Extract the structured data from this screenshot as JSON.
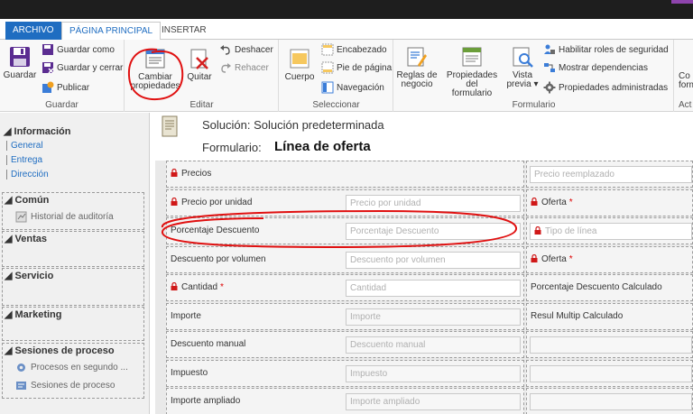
{
  "tabs": {
    "archivo": "ARCHIVO",
    "principal": "PÁGINA PRINCIPAL",
    "insertar": "INSERTAR"
  },
  "ribbon": {
    "guardar": {
      "save": "Guardar",
      "save_as": "Guardar como",
      "save_close": "Guardar y cerrar",
      "publish": "Publicar",
      "label": "Guardar"
    },
    "editar": {
      "change_props_1": "Cambiar",
      "change_props_2": "propiedades",
      "remove": "Quitar",
      "undo": "Deshacer",
      "redo": "Rehacer",
      "label": "Editar"
    },
    "seleccionar": {
      "body": "Cuerpo",
      "header": "Encabezado",
      "footer": "Pie de página",
      "navigation": "Navegación",
      "label": "Seleccionar"
    },
    "formulario": {
      "rules_1": "Reglas de",
      "rules_2": "negocio",
      "form_props_1": "Propiedades del",
      "form_props_2": "formulario",
      "preview_1": "Vista",
      "preview_2": "previa",
      "security_roles": "Habilitar roles de seguridad",
      "dependencies": "Mostrar dependencias",
      "managed_props": "Propiedades administradas",
      "label": "Formulario"
    },
    "cut_1": "Co",
    "cut_2": "form",
    "cut_label": "Act"
  },
  "leftnav": {
    "info_header": "Información",
    "info_items": [
      "General",
      "Entrega",
      "Dirección"
    ],
    "sections": [
      {
        "title": "Común",
        "items": [
          "Historial de auditoría"
        ]
      },
      {
        "title": "Ventas",
        "items": []
      },
      {
        "title": "Servicio",
        "items": []
      },
      {
        "title": "Marketing",
        "items": []
      },
      {
        "title": "Sesiones de proceso",
        "items": [
          "Procesos en segundo ...",
          "Sesiones de proceso"
        ]
      }
    ]
  },
  "header": {
    "solution": "Solución: Solución predeterminada",
    "form_label": "Formulario:",
    "form_name": "Línea de oferta"
  },
  "form": {
    "rows": [
      {
        "label": "Precios",
        "placeholder": "",
        "locked": true,
        "required": false,
        "right_label": "",
        "right_value": "Precio reemplazado",
        "right_locked": false
      },
      {
        "label": "Precio por unidad",
        "placeholder": "Precio por unidad",
        "locked": true,
        "required": false,
        "right_label": "Oferta",
        "right_value": "",
        "right_locked": true
      },
      {
        "label": "Porcentaje Descuento",
        "placeholder": "Porcentaje Descuento",
        "locked": false,
        "required": false,
        "right_label": "",
        "right_value": "Tipo de línea",
        "right_locked": true
      },
      {
        "label": "Descuento por volumen",
        "placeholder": "Descuento por volumen",
        "locked": false,
        "required": false,
        "right_label": "Oferta",
        "right_value": "",
        "right_locked": true
      },
      {
        "label": "Cantidad",
        "placeholder": "Cantidad",
        "locked": true,
        "required": true,
        "right_label": "Porcentaje Descuento Calculado",
        "right_value": "",
        "right_locked": false
      },
      {
        "label": "Importe",
        "placeholder": "Importe",
        "locked": false,
        "required": false,
        "right_label": "Resul Multip Calculado",
        "right_value": "",
        "right_locked": false
      },
      {
        "label": "Descuento manual",
        "placeholder": "Descuento manual",
        "locked": false,
        "required": false,
        "right_label": "",
        "right_value": "",
        "right_locked": false
      },
      {
        "label": "Impuesto",
        "placeholder": "Impuesto",
        "locked": false,
        "required": false,
        "right_label": "",
        "right_value": "",
        "right_locked": false
      },
      {
        "label": "Importe ampliado",
        "placeholder": "Importe ampliado",
        "locked": false,
        "required": false,
        "right_label": "",
        "right_value": "",
        "right_locked": false
      }
    ]
  },
  "colors": {
    "accent": "#1f6dc1",
    "annotation": "#e01010",
    "lock": "#d01818"
  }
}
